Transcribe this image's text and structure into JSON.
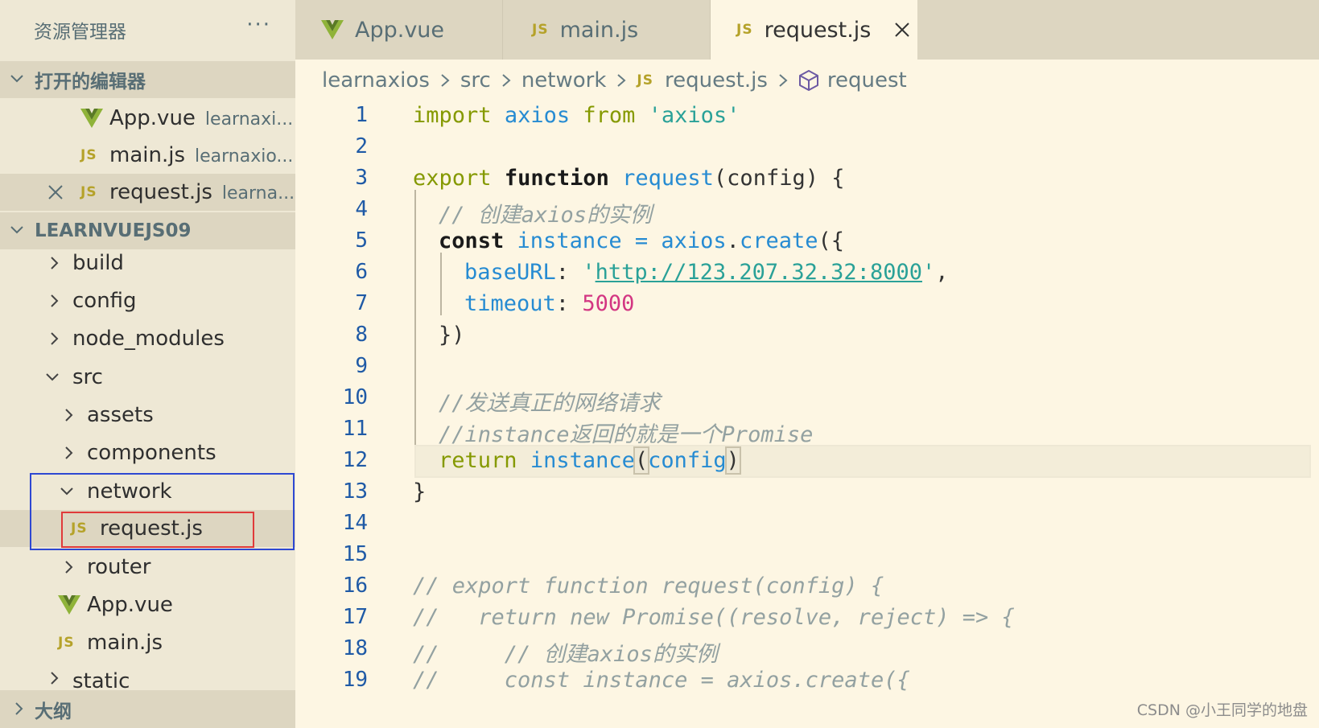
{
  "sidebar": {
    "title": "资源管理器",
    "more_icon": "ellipsis-icon",
    "open_editors": {
      "header": "打开的编辑器",
      "items": [
        {
          "name": "App.vue",
          "desc": "learnaxi...",
          "icon": "vue-icon"
        },
        {
          "name": "main.js",
          "desc": "learnaxio...",
          "icon": "js-icon"
        },
        {
          "name": "request.js",
          "desc": "learna...",
          "icon": "js-icon",
          "active": true
        }
      ]
    },
    "project": {
      "header": "LEARNVUEJS09",
      "items": [
        {
          "label": "build",
          "type": "folder"
        },
        {
          "label": "config",
          "type": "folder"
        },
        {
          "label": "node_modules",
          "type": "folder"
        },
        {
          "label": "src",
          "type": "folder-open"
        },
        {
          "label": "assets",
          "type": "folder"
        },
        {
          "label": "components",
          "type": "folder"
        },
        {
          "label": "network",
          "type": "folder-open"
        },
        {
          "label": "request.js",
          "type": "js"
        },
        {
          "label": "router",
          "type": "folder"
        },
        {
          "label": "App.vue",
          "type": "vue"
        },
        {
          "label": "main.js",
          "type": "js"
        },
        {
          "label": "static",
          "type": "folder"
        }
      ]
    },
    "outline": {
      "header": "大纲"
    }
  },
  "tabs": [
    {
      "label": "App.vue",
      "icon": "vue-icon"
    },
    {
      "label": "main.js",
      "icon": "js-icon"
    },
    {
      "label": "request.js",
      "icon": "js-icon",
      "active": true
    }
  ],
  "js_badge": "JS",
  "breadcrumb": [
    "learnaxios",
    "src",
    "network",
    "request.js",
    "request"
  ],
  "editor": {
    "line_numbers": [
      "1",
      "2",
      "3",
      "4",
      "5",
      "6",
      "7",
      "8",
      "9",
      "10",
      "11",
      "12",
      "13",
      "14",
      "15",
      "16",
      "17",
      "18",
      "19"
    ],
    "l1": {
      "t1": "import",
      "t2": "axios",
      "t3": "from",
      "t4": "'axios'"
    },
    "l3": {
      "t1": "export",
      "t2": "function",
      "t3": "request",
      "t4": "(config) {"
    },
    "l4": "// 创建axios的实例",
    "l5": {
      "t1": "const",
      "t2": "instance",
      "t3": "=",
      "t4": "axios",
      "t5": ".",
      "t6": "create",
      "t7": "({"
    },
    "l6": {
      "t1": "baseURL",
      "t2": ": ",
      "t3": "'",
      "t4": "http://123.207.32.32:8000",
      "t5": "'",
      "t6": ","
    },
    "l7": {
      "t1": "timeout",
      "t2": ": ",
      "t3": "5000"
    },
    "l8": "})",
    "l10": "//发送真正的网络请求",
    "l11": "//instance返回的就是一个Promise",
    "l12": {
      "t1": "return",
      "t2": "instance",
      "t3": "(",
      "t4": "config",
      "t5": ")"
    },
    "l13": "}",
    "l16": "// export function request(config) {",
    "l17": "//   return new Promise((resolve, reject) => {",
    "l18": "//     // 创建axios的实例",
    "l19": "//     const instance = axios.create({"
  },
  "watermark": "CSDN @小王同学的地盘",
  "colors": {
    "keyword": "#859900",
    "function": "#268bd2",
    "string": "#2aa198",
    "number": "#d33682",
    "comment": "#93a1a1"
  }
}
